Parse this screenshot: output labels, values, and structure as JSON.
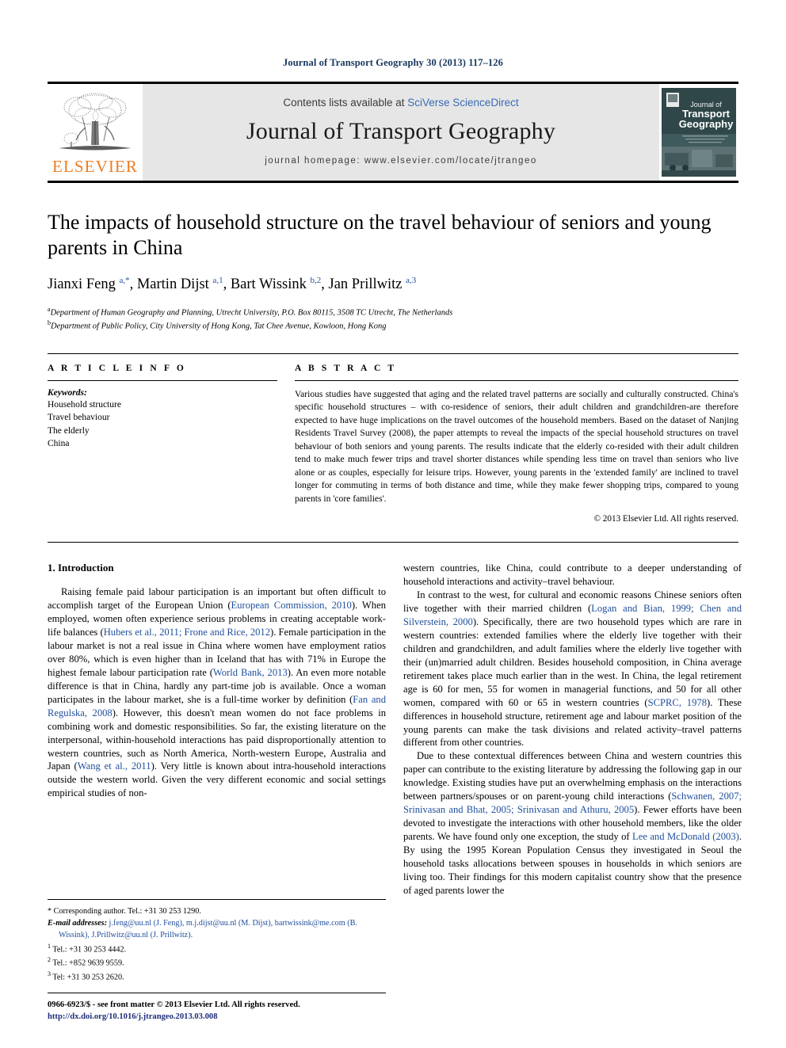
{
  "running_head": "Journal of Transport Geography 30 (2013) 117–126",
  "masthead": {
    "contents_prefix": "Contents lists available at ",
    "sciencedirect": "SciVerse ScienceDirect",
    "journal_title": "Journal of Transport Geography",
    "homepage": "journal homepage: www.elsevier.com/locate/jtrangeo",
    "publisher_name": "ELSEVIER",
    "cover_title_line1": "Journal of",
    "cover_title_line2": "Transport",
    "cover_title_line3": "Geography",
    "accent_orange": "#ef7d22",
    "link_blue": "#3a6bb5"
  },
  "article": {
    "title": "The impacts of household structure on the travel behaviour of seniors and young parents in China",
    "authors_html": "Jianxi Feng <sup>a,*</sup>, Martin Dijst <sup>a,1</sup>, Bart Wissink <sup>b,2</sup>, Jan Prillwitz <sup>a,3</sup>",
    "affiliation_a": "Department of Human Geography and Planning, Utrecht University, P.O. Box 80115, 3508 TC Utrecht, The Netherlands",
    "affiliation_b": "Department of Public Policy, City University of Hong Kong, Tat Chee Avenue, Kowloon, Hong Kong"
  },
  "article_info": {
    "heading": "A R T I C L E   I N F O",
    "keywords_label": "Keywords:",
    "keywords": [
      "Household structure",
      "Travel behaviour",
      "The elderly",
      "China"
    ]
  },
  "abstract": {
    "heading": "A B S T R A C T",
    "text": "Various studies have suggested that aging and the related travel patterns are socially and culturally constructed. China's specific household structures – with co-residence of seniors, their adult children and grandchildren-are therefore expected to have huge implications on the travel outcomes of the household members. Based on the dataset of Nanjing Residents Travel Survey (2008), the paper attempts to reveal the impacts of the special household structures on travel behaviour of both seniors and young parents. The results indicate that the elderly co-resided with their adult children tend to make much fewer trips and travel shorter distances while spending less time on travel than seniors who live alone or as couples, especially for leisure trips. However, young parents in the 'extended family' are inclined to travel longer for commuting in terms of both distance and time, while they make fewer shopping trips, compared to young parents in 'core families'.",
    "copyright": "© 2013 Elsevier Ltd. All rights reserved."
  },
  "body": {
    "section_number_title": "1. Introduction",
    "left_para_1": "Raising female paid labour participation is an important but often difficult to accomplish target of the European Union (European Commission, 2010). When employed, women often experience serious problems in creating acceptable work-life balances (Hubers et al., 2011; Frone and Rice, 2012). Female participation in the labour market is not a real issue in China where women have employment ratios over 80%, which is even higher than in Iceland that has with 71% in Europe the highest female labour participation rate (World Bank, 2013). An even more notable difference is that in China, hardly any part-time job is available. Once a woman participates in the labour market, she is a full-time worker by definition (Fan and Regulska, 2008). However, this doesn't mean women do not face problems in combining work and domestic responsibilities. So far, the existing literature on the interpersonal, within-household interactions has paid disproportionally attention to western countries, such as North America, North-western Europe, Australia and Japan (Wang et al., 2011). Very little is known about intra-household interactions outside the western world. Given the very different economic and social settings empirical studies of non-",
    "right_para_1_cont": "western countries, like China, could contribute to a deeper understanding of household interactions and activity–travel behaviour.",
    "right_para_2": "In contrast to the west, for cultural and economic reasons Chinese seniors often live together with their married children (Logan and Bian, 1999; Chen and Silverstein, 2000). Specifically, there are two household types which are rare in western countries: extended families where the elderly live together with their children and grandchildren, and adult families where the elderly live together with their (un)married adult children. Besides household composition, in China average retirement takes place much earlier than in the west. In China, the legal retirement age is 60 for men, 55 for women in managerial functions, and 50 for all other women, compared with 60 or 65 in western countries (SCPRC, 1978). These differences in household structure, retirement age and labour market position of the young parents can make the task divisions and related activity–travel patterns different from other countries.",
    "right_para_3": "Due to these contextual differences between China and western countries this paper can contribute to the existing literature by addressing the following gap in our knowledge. Existing studies have put an overwhelming emphasis on the interactions between partners/spouses or on parent-young child interactions (Schwanen, 2007; Srinivasan and Bhat, 2005; Srinivasan and Athuru, 2005). Fewer efforts have been devoted to investigate the interactions with other household members, like the older parents. We have found only one exception, the study of Lee and McDonald (2003). By using the 1995 Korean Population Census they investigated in Seoul the household tasks allocations between spouses in households in which seniors are living too. Their findings for this modern capitalist country show that the presence of aged parents lower the"
  },
  "footnotes": {
    "corresponding": "* Corresponding author. Tel.: +31 30 253 1290.",
    "email_label": "E-mail addresses:",
    "emails": "j.feng@uu.nl (J. Feng), m.j.dijst@uu.nl (M. Dijst), bartwissink@me.com (B. Wissink), J.Prillwitz@uu.nl (J. Prillwitz).",
    "note_1": "Tel.: +31 30 253 4442.",
    "note_2": "Tel.: +852 9639 9559.",
    "note_3": "Tel: +31 30 253 2620."
  },
  "imprint": {
    "issn_line": "0966-6923/$ - see front matter © 2013 Elsevier Ltd. All rights reserved.",
    "doi": "http://dx.doi.org/10.1016/j.jtrangeo.2013.03.008"
  }
}
